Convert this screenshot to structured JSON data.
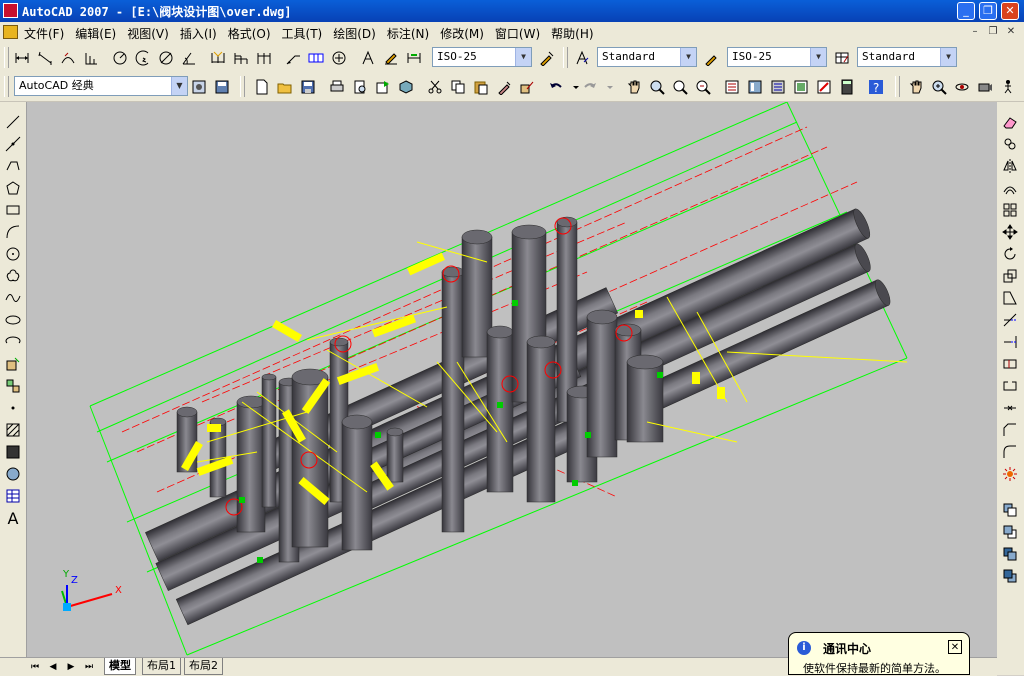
{
  "window": {
    "title": "AutoCAD 2007 - [E:\\阀块设计图\\over.dwg]",
    "controls": {
      "minimize": "_",
      "restore": "❐",
      "close": "✕"
    }
  },
  "menubar": {
    "items": [
      "文件(F)",
      "编辑(E)",
      "视图(V)",
      "插入(I)",
      "格式(O)",
      "工具(T)",
      "绘图(D)",
      "标注(N)",
      "修改(M)",
      "窗口(W)",
      "帮助(H)"
    ],
    "mdi_controls": {
      "minimize": "–",
      "restore": "❐",
      "close": "✕"
    }
  },
  "toolbar_styles": {
    "dim_style": "ISO-25",
    "text_style": "Standard",
    "dim_style_2": "ISO-25",
    "table_style": "Standard"
  },
  "workspace": {
    "selected": "AutoCAD 经典"
  },
  "layouts": {
    "tabs": [
      "模型",
      "布局1",
      "布局2"
    ],
    "active": 0
  },
  "notification": {
    "title": "通讯中心",
    "message": "使软件保持最新的简单方法。",
    "icon": "info-icon"
  },
  "ucs_icon": {
    "x_label": "X",
    "y_label": "Y",
    "z_label": "Z"
  },
  "colors": {
    "title_bar": "#0a5fd8",
    "canvas_background": "#c0c0c0",
    "pipe": "#5d5c63",
    "bbox_green": "#00ff00",
    "dim_yellow": "#ffff00",
    "dim_red": "#ff0000"
  }
}
